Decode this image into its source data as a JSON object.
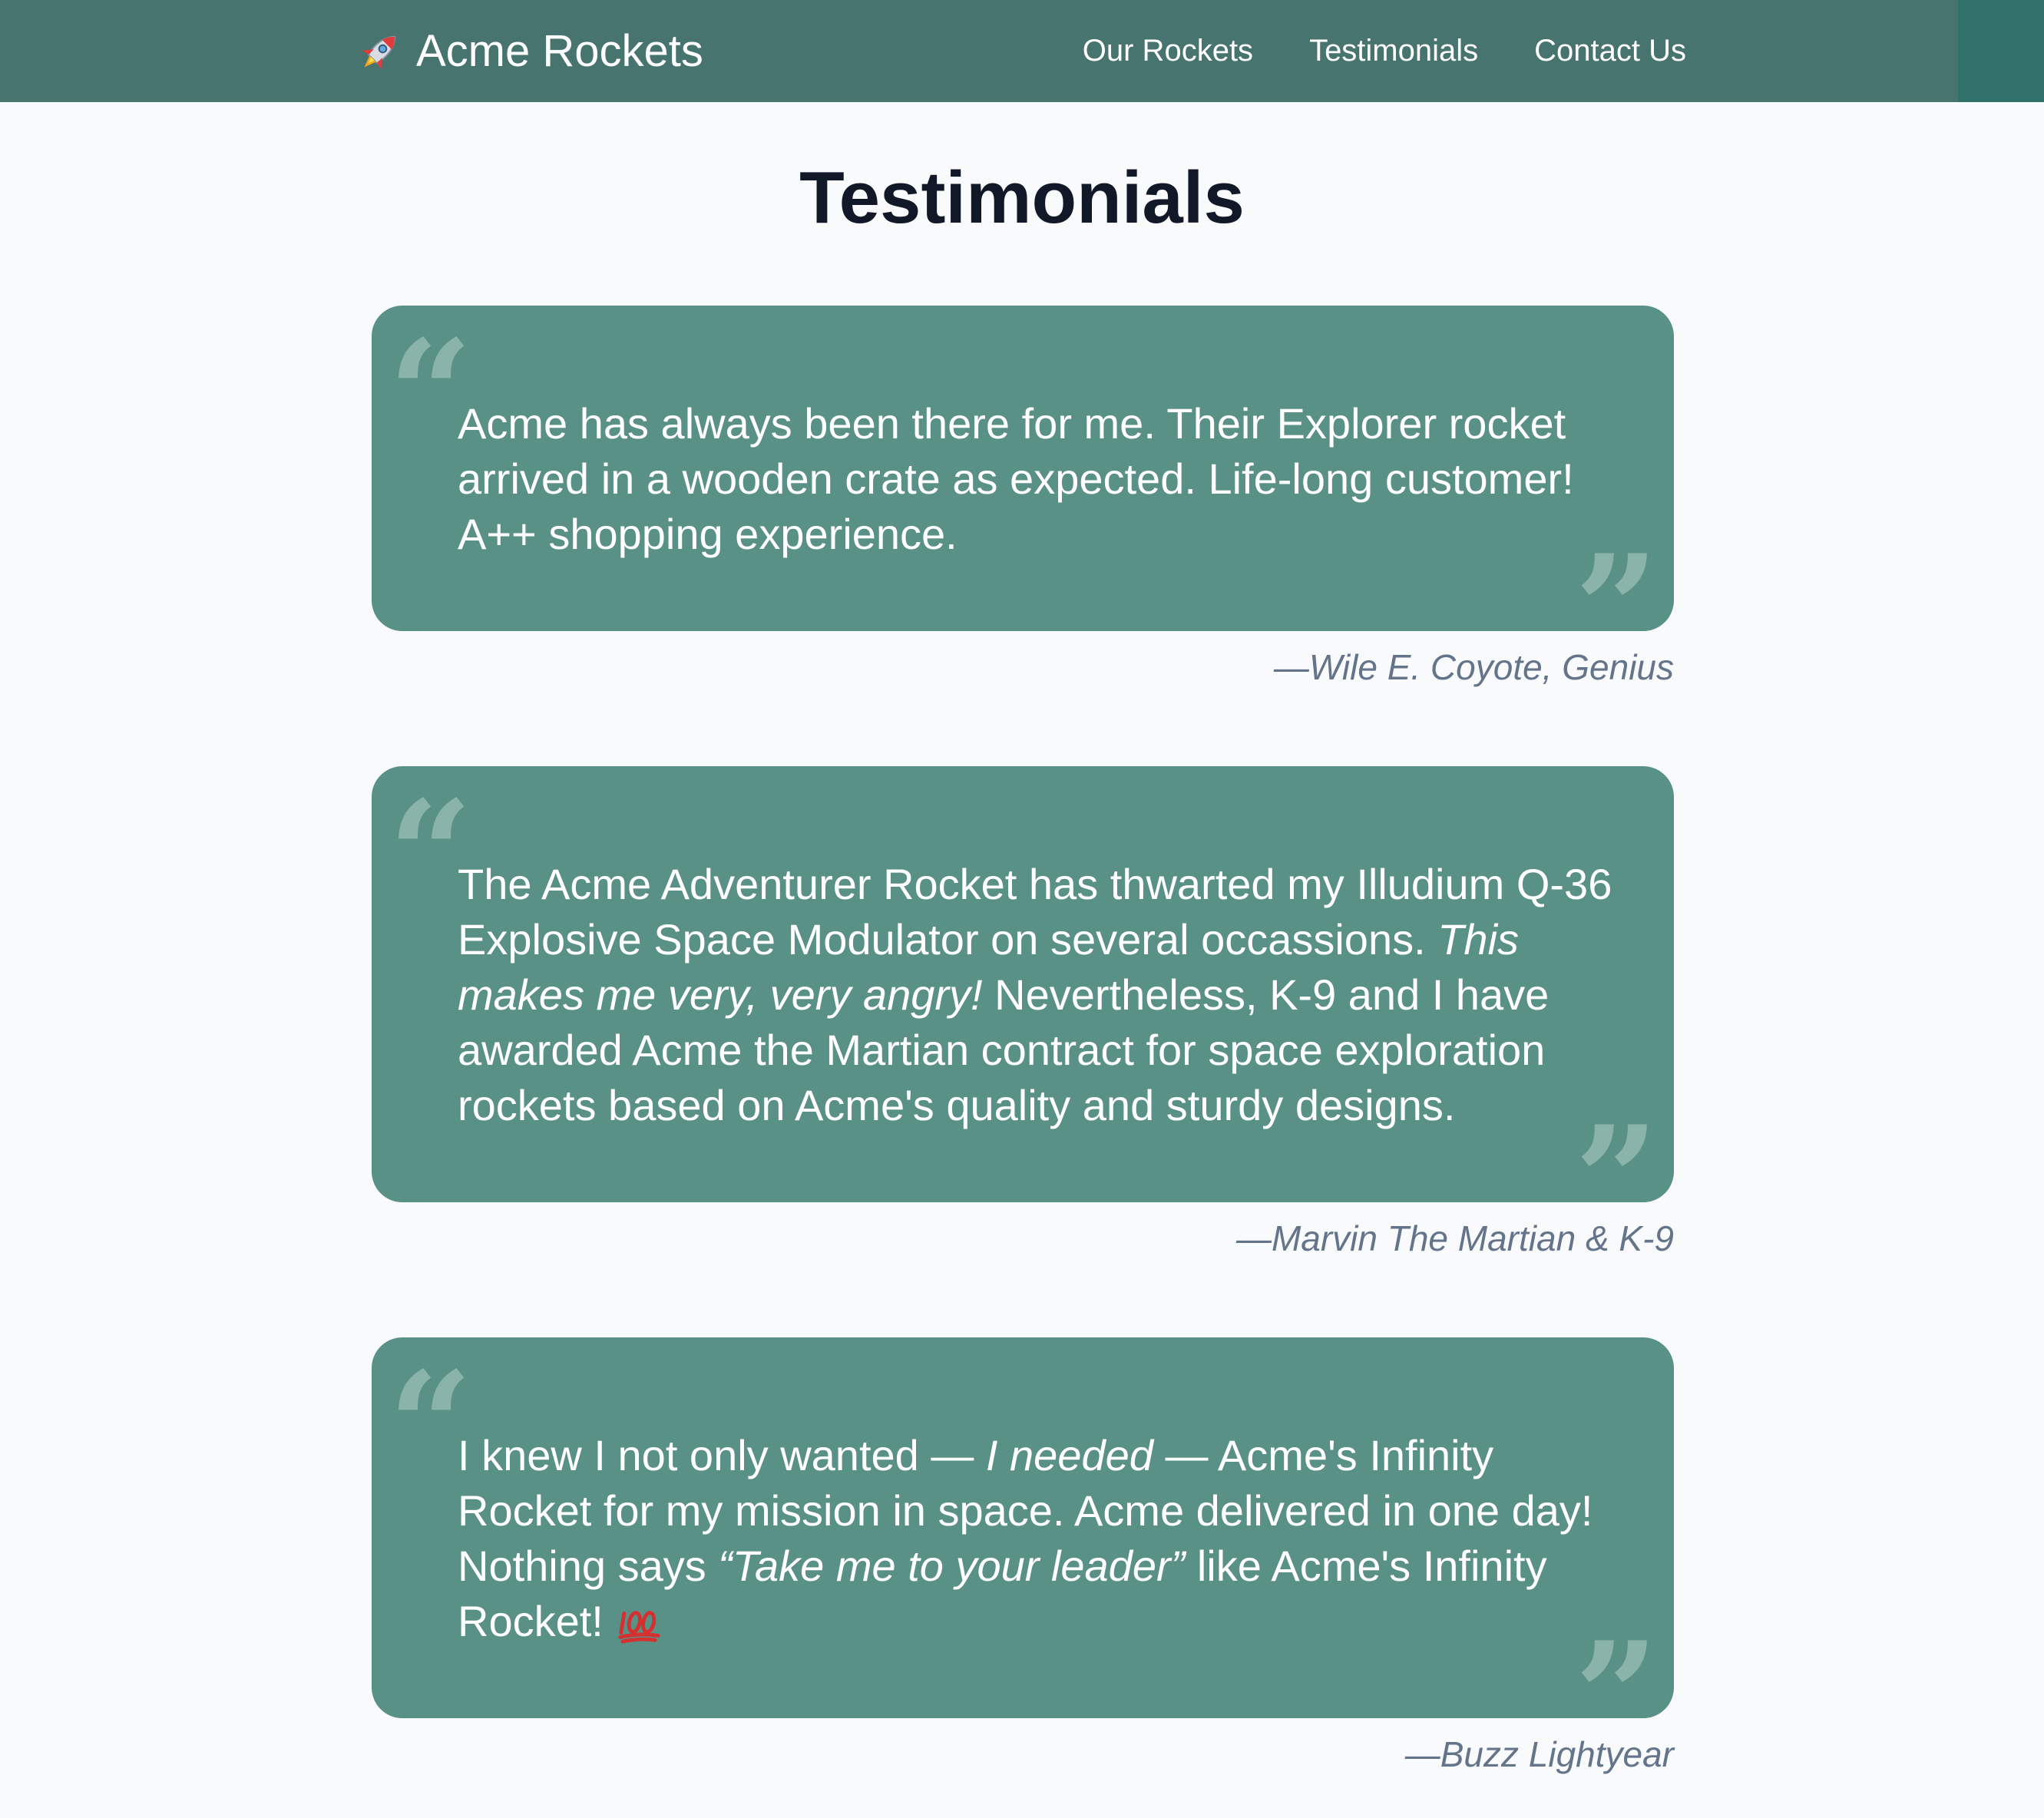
{
  "colors": {
    "navbar": "#47746f",
    "navbar_accent": "#30716a",
    "card": "#5a9186",
    "quote_mark": "#8ab3aa",
    "page_background": "#f8fafc",
    "title": "#111827",
    "attribution": "#64748b"
  },
  "nav": {
    "brand_icon": "rocket-icon",
    "brand": "Acme Rockets",
    "links": [
      "Our Rockets",
      "Testimonials",
      "Contact Us"
    ]
  },
  "page": {
    "title": "Testimonials"
  },
  "testimonials": [
    {
      "text": "Acme has always been there for me. Their Explorer rocket arrived in a wooden crate as expected. Life-long customer! A++ shopping experience.",
      "author": "—Wile E. Coyote, Genius"
    },
    {
      "text_1": "The Acme Adventurer Rocket has thwarted my Illudium Q-36 Explosive Space Modulator on several occassions. ",
      "emphasis": "This makes me very, very angry!",
      "text_2": " Nevertheless, K-9 and I have awarded Acme the Martian contract for space exploration rockets based on Acme's quality and sturdy designs.",
      "author": "—Marvin The Martian & K-9"
    },
    {
      "text_1": "I knew I not only wanted — ",
      "emphasis_1": "I needed",
      "text_2": " — Acme's Infinity Rocket for my mission in space. Acme delivered in one day! Nothing says ",
      "emphasis_2": "“Take me to your leader”",
      "text_3": " like Acme's Infinity Rocket! ",
      "emoji": "hundred-points-icon",
      "author": "—Buzz Lightyear"
    }
  ],
  "quote_marks": {
    "open": "“",
    "close": "”"
  }
}
